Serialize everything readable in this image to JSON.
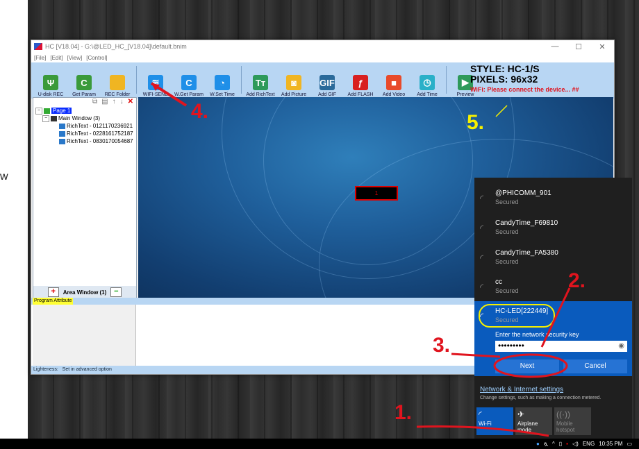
{
  "app": {
    "title": "HC [V18.04] - G:\\@LED_HC_[V18.04]\\default.bnim",
    "controls": [
      "—",
      "☐",
      "✕"
    ],
    "menu": [
      "[File]",
      "[Edit]",
      "[View]",
      "[Control]"
    ],
    "toolbar": [
      {
        "label": "U-disk REC",
        "icon": "usb-icon",
        "glyph": "Ψ",
        "color": "#3a9a3a"
      },
      {
        "label": "Get Param",
        "icon": "refresh-icon",
        "glyph": "C",
        "color": "#3a9a3a"
      },
      {
        "label": "REC Folder",
        "icon": "folder-icon",
        "glyph": "",
        "color": "#f0b522"
      },
      {
        "label": "WIFI-SEND",
        "icon": "wifi-icon",
        "glyph": "≋",
        "color": "#1f8fe8"
      },
      {
        "label": "W.Get Param",
        "icon": "refresh-icon",
        "glyph": "C",
        "color": "#1f8fe8"
      },
      {
        "label": "W.Set Time",
        "icon": "clock-icon",
        "glyph": "◔",
        "color": "#1f8fe8"
      },
      {
        "label": "Add RichText",
        "icon": "text-icon",
        "glyph": "Tт",
        "color": "#2e9a5a"
      },
      {
        "label": "Add Picture",
        "icon": "picture-icon",
        "glyph": "◙",
        "color": "#f0b522"
      },
      {
        "label": "Add GIF",
        "icon": "gif-icon",
        "glyph": "GIF",
        "color": "#2a6a9a"
      },
      {
        "label": "Add FLASH",
        "icon": "flash-icon",
        "glyph": "ƒ",
        "color": "#d82020"
      },
      {
        "label": "Add Video",
        "icon": "video-icon",
        "glyph": "■",
        "color": "#e84a2a"
      },
      {
        "label": "Add Time",
        "icon": "alarm-icon",
        "glyph": "◷",
        "color": "#2ab0c8"
      },
      {
        "label": "Preview",
        "icon": "play-icon",
        "glyph": "▶",
        "color": "#2e9a5a"
      }
    ],
    "style_line": "STYLE: HC-1/S",
    "pixels_line": "PIXELS: 96x32",
    "wifi_warning": "WiFi: Please connect the device... ##",
    "tree": {
      "page": "Page 1",
      "window": "Main Window  (3)",
      "items": [
        "RichText - 0121170236921",
        "RichText - 0228161752187",
        "RichText - 0830170054687"
      ]
    },
    "area_window": "Area Window (1)",
    "program_attribute": "Program Attribute",
    "status": {
      "label": "Lighteness:",
      "value": "Set in advanced option"
    },
    "led_text": "1"
  },
  "wifi": {
    "networks": [
      {
        "name": "@PHICOMM_901",
        "status": "Secured"
      },
      {
        "name": "CandyTime_F69810",
        "status": "Secured"
      },
      {
        "name": "CandyTime_FA5380",
        "status": "Secured"
      },
      {
        "name": "cc",
        "status": "Secured"
      }
    ],
    "active": {
      "name": "HC-LED[222449]",
      "status": "Secured"
    },
    "key_label": "Enter the network security key",
    "password": "•••••••••",
    "next": "Next",
    "cancel": "Cancel",
    "settings_link": "Network & Internet settings",
    "settings_sub": "Change settings, such as making a connection metered.",
    "tiles": [
      {
        "label": "Wi-Fi",
        "icon": "wifi-icon",
        "active": true
      },
      {
        "label": "Airplane mode",
        "icon": "airplane-icon",
        "active": false
      },
      {
        "label": "Mobile hotspot",
        "icon": "hotspot-icon",
        "active": false
      }
    ]
  },
  "taskbar": {
    "lang": "ENG",
    "time": "10:35 PM"
  },
  "annotations": {
    "a1": "1.",
    "a2": "2.",
    "a3": "3.",
    "a4": "4.",
    "a5": "5."
  },
  "edge_text": "w"
}
